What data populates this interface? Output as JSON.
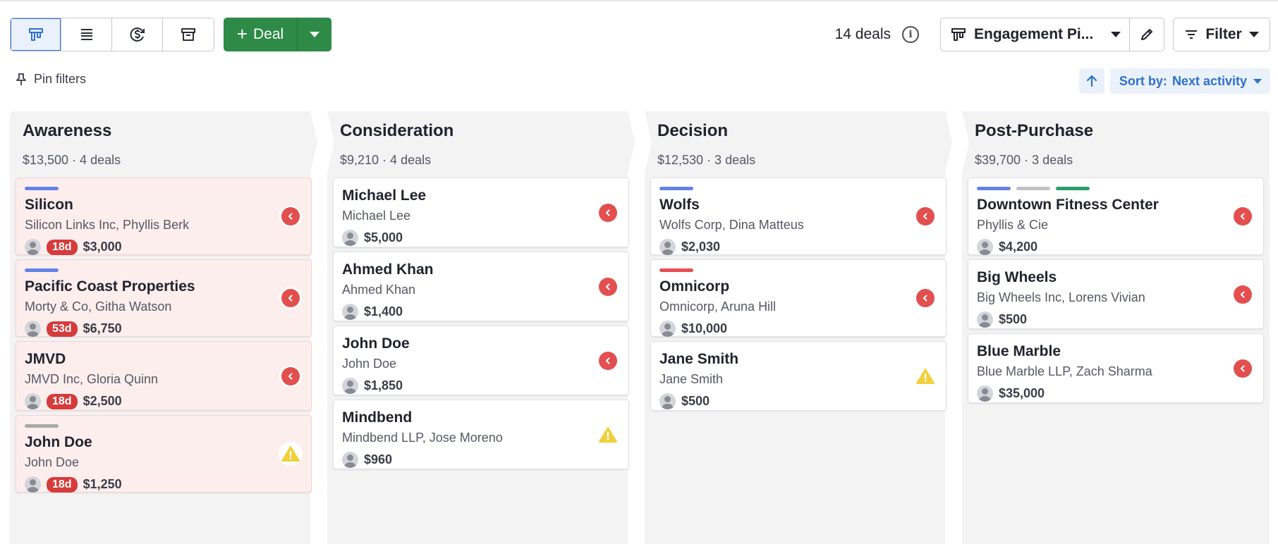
{
  "toolbar": {
    "views": [
      {
        "icon": "pipeline-view-icon",
        "active": true
      },
      {
        "icon": "list-view-icon",
        "active": false
      },
      {
        "icon": "forecast-view-icon",
        "active": false
      },
      {
        "icon": "archive-view-icon",
        "active": false
      }
    ],
    "add_deal_label": "Deal",
    "deal_count": "14 deals",
    "pipeline_label": "Engagement Pi...",
    "filter_label": "Filter"
  },
  "subbar": {
    "pin_filters_label": "Pin filters",
    "sort_by_label": "Sort by:",
    "sort_by_value": "Next activity"
  },
  "colors": {
    "accent": "#2f71c9",
    "primary_green": "#2d8a47",
    "rotten_bg": "#fdeeee",
    "badge_red": "#d63b3b",
    "tag_blue": "#6382e6",
    "tag_gray": "#a9a9a9",
    "tag_green": "#27a06a",
    "tag_red": "#e94d52"
  },
  "columns": [
    {
      "title": "Awareness",
      "summary": "$13,500 · 4 deals",
      "cards": [
        {
          "title": "Silicon",
          "subtitle": "Silicon Links Inc, Phyllis Berk",
          "badge": "18d",
          "value": "$3,000",
          "tags": [
            "#6382e6"
          ],
          "rotten": true,
          "status": "overdue"
        },
        {
          "title": "Pacific Coast Properties",
          "subtitle": "Morty & Co, Githa Watson",
          "badge": "53d",
          "value": "$6,750",
          "tags": [
            "#6382e6"
          ],
          "rotten": true,
          "status": "overdue"
        },
        {
          "title": "JMVD",
          "subtitle": "JMVD Inc, Gloria Quinn",
          "badge": "18d",
          "value": "$2,500",
          "tags": [],
          "rotten": true,
          "status": "overdue"
        },
        {
          "title": "John Doe",
          "subtitle": "John Doe",
          "badge": "18d",
          "value": "$1,250",
          "tags": [
            "#a9a9a9"
          ],
          "rotten": true,
          "status": "warning"
        }
      ]
    },
    {
      "title": "Consideration",
      "summary": "$9,210 · 4 deals",
      "cards": [
        {
          "title": "Michael Lee",
          "subtitle": "Michael Lee",
          "badge": "",
          "value": "$5,000",
          "tags": [],
          "rotten": false,
          "status": "overdue"
        },
        {
          "title": "Ahmed Khan",
          "subtitle": "Ahmed Khan",
          "badge": "",
          "value": "$1,400",
          "tags": [],
          "rotten": false,
          "status": "overdue"
        },
        {
          "title": "John Doe",
          "subtitle": "John Doe",
          "badge": "",
          "value": "$1,850",
          "tags": [],
          "rotten": false,
          "status": "overdue"
        },
        {
          "title": "Mindbend",
          "subtitle": "Mindbend LLP, Jose Moreno",
          "badge": "",
          "value": "$960",
          "tags": [],
          "rotten": false,
          "status": "warning"
        }
      ]
    },
    {
      "title": "Decision",
      "summary": "$12,530 · 3 deals",
      "cards": [
        {
          "title": "Wolfs",
          "subtitle": "Wolfs Corp, Dina Matteus",
          "badge": "",
          "value": "$2,030",
          "tags": [
            "#6382e6"
          ],
          "rotten": false,
          "status": "overdue"
        },
        {
          "title": "Omnicorp",
          "subtitle": "Omnicorp, Aruna Hill",
          "badge": "",
          "value": "$10,000",
          "tags": [
            "#e94d52"
          ],
          "rotten": false,
          "status": "overdue"
        },
        {
          "title": "Jane Smith",
          "subtitle": "Jane Smith",
          "badge": "",
          "value": "$500",
          "tags": [],
          "rotten": false,
          "status": "warning"
        }
      ]
    },
    {
      "title": "Post-Purchase",
      "summary": "$39,700 · 3 deals",
      "cards": [
        {
          "title": "Downtown Fitness Center",
          "subtitle": "Phyllis & Cie",
          "badge": "",
          "value": "$4,200",
          "tags": [
            "#6382e6",
            "#c2c2c2",
            "#27a06a"
          ],
          "rotten": false,
          "status": "overdue"
        },
        {
          "title": "Big Wheels",
          "subtitle": "Big Wheels Inc, Lorens Vivian",
          "badge": "",
          "value": "$500",
          "tags": [],
          "rotten": false,
          "status": "overdue"
        },
        {
          "title": "Blue Marble",
          "subtitle": "Blue Marble LLP, Zach Sharma",
          "badge": "",
          "value": "$35,000",
          "tags": [],
          "rotten": false,
          "status": "overdue"
        }
      ]
    }
  ]
}
